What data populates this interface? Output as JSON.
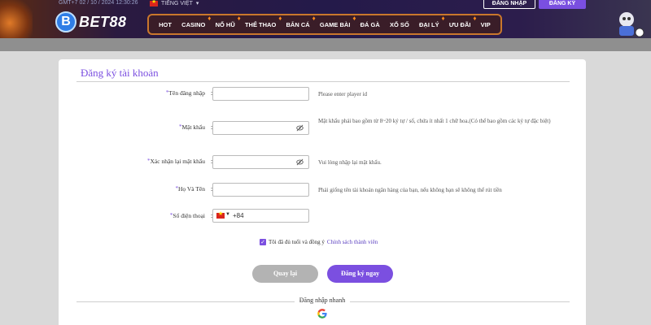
{
  "header": {
    "time": "GMT+7 02 / 10 / 2024 12:30:26",
    "language": "TIẾNG VIỆT",
    "login_label": "ĐĂNG NHẬP",
    "register_label": "ĐĂNG KÝ",
    "logo_letter": "B",
    "logo_text": "BET88",
    "nav": [
      "HOT",
      "CASINO",
      "NỔ HŨ",
      "THỂ THAO",
      "BẮN CÁ",
      "GAME BÀI",
      "ĐÁ GÀ",
      "XỔ SỐ",
      "ĐẠI LÝ",
      "ƯU ĐÃI",
      "VIP"
    ]
  },
  "form": {
    "title": "Đăng ký tài khoản",
    "username": {
      "label": "Tên đăng nhập",
      "value": "",
      "hint": "Please enter player id"
    },
    "password": {
      "label": "Mật khẩu",
      "value": "",
      "hint": "Mật khẩu phải bao gồm từ 8~20 ký tự / số, chứa ít nhất 1 chữ hoa.(Có thể bao gồm các ký tự đặc biệt)"
    },
    "confirm_password": {
      "label": "Xác nhận lại mật khẩu",
      "value": "",
      "hint": "Vui lòng nhập lại mật khẩu."
    },
    "fullname": {
      "label": "Họ Và Tên",
      "value": "",
      "hint": "Phải giống tên tài khoản ngân hàng của bạn, nếu không bạn sẽ không thể rút tiền"
    },
    "phone": {
      "label": "Số điện thoại",
      "code": "+84",
      "value": ""
    },
    "agree_text": "Tôi đã đủ tuổi và đồng ý",
    "policy_link": "Chính sách thành viên",
    "back_label": "Quay lại",
    "submit_label": "Đăng ký ngay",
    "quick_login": "Đăng nhập nhanh"
  },
  "icons": {
    "eye": "eye-off-icon",
    "google": "google-icon",
    "check": "check-icon",
    "flag": "vietnam-flag-icon"
  },
  "colors": {
    "accent": "#7b4fe0",
    "header_bg": "#241a4a",
    "nav_border": "#c9772c",
    "back_button": "#b3b3b3"
  }
}
